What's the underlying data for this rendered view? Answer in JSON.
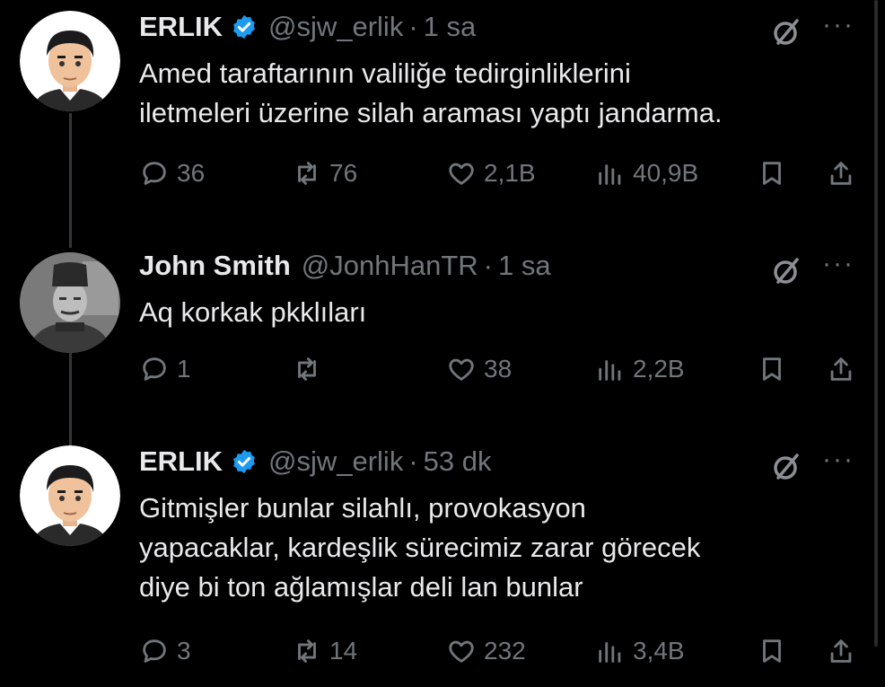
{
  "tweets": [
    {
      "name": "ERLIK",
      "verified": true,
      "handle": "@sjw_erlik",
      "time": "1 sa",
      "text_lines": [
        "Amed taraftarının valiliğe tedirginliklerini",
        "iletmeleri üzerine silah araması yaptı jandarma."
      ],
      "replies": "36",
      "reposts": "76",
      "likes": "2,1B",
      "views": "40,9B"
    },
    {
      "name": "John Smith",
      "verified": false,
      "handle": "@JonhHanTR",
      "time": "1 sa",
      "text_lines": [
        "Aq korkak pkklıları"
      ],
      "replies": "1",
      "reposts": "",
      "likes": "38",
      "views": "2,2B"
    },
    {
      "name": "ERLIK",
      "verified": true,
      "handle": "@sjw_erlik",
      "time": "53 dk",
      "text_lines": [
        "Gitmişler bunlar silahlı, provokasyon",
        "yapacaklar, kardeşlik sürecimiz zarar görecek",
        "diye bi ton ağlamışlar deli lan bunlar"
      ],
      "replies": "3",
      "reposts": "14",
      "likes": "232",
      "views": "3,4B"
    }
  ],
  "header": {
    "dot": "·",
    "more": "···"
  },
  "colors": {
    "background": "#000000",
    "text": "#e7e9ea",
    "muted": "#71767b",
    "verified": "#1d9bf0"
  },
  "icons": [
    "verified-badge-icon",
    "grok-icon",
    "more-icon",
    "reply-icon",
    "repost-icon",
    "like-icon",
    "views-icon",
    "bookmark-icon",
    "share-icon"
  ]
}
